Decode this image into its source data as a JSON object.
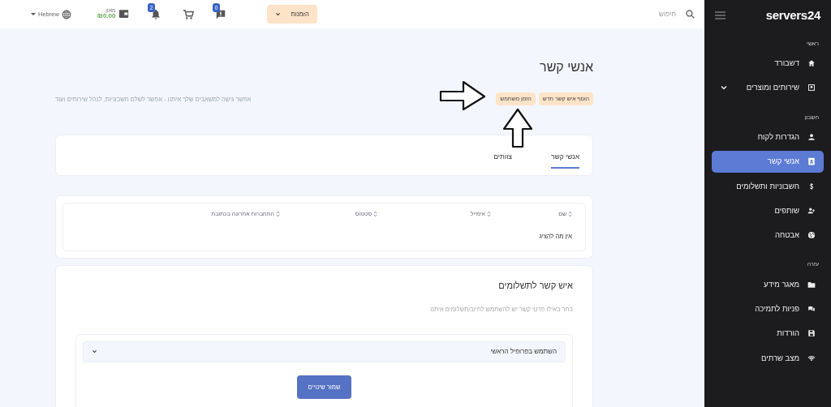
{
  "sidebar": {
    "logo": "servers24",
    "sections": [
      {
        "label": "ראשי",
        "items": [
          {
            "label": "דשבורד",
            "kind": "link",
            "selected": false
          },
          {
            "label": "שירותים ומוצרים",
            "kind": "submenu",
            "selected": false
          }
        ]
      },
      {
        "label": "חשבון",
        "items": [
          {
            "label": "הגדרות לקוח",
            "kind": "link",
            "selected": false
          },
          {
            "label": "אנשי קשר",
            "kind": "link",
            "selected": true
          },
          {
            "label": "חשבוניות ותשלומים",
            "kind": "link",
            "selected": false
          },
          {
            "label": "שותפים",
            "kind": "link",
            "selected": false
          },
          {
            "label": "אבטחה",
            "kind": "link",
            "selected": false
          }
        ]
      },
      {
        "label": "עזרה",
        "items": [
          {
            "label": "מאגר מידע",
            "kind": "link",
            "selected": false
          },
          {
            "label": "פניות לתמיכה",
            "kind": "link",
            "selected": false
          },
          {
            "label": "הורדות",
            "kind": "link",
            "selected": false
          },
          {
            "label": "מצב שרתים",
            "kind": "link",
            "selected": false
          }
        ]
      }
    ]
  },
  "header": {
    "search": {
      "placeholder": "חיפוש"
    },
    "orders_button": "הזמנות",
    "messages_badge": "0",
    "notifications_badge": "2",
    "wallet": {
      "label": "מאזן",
      "amount": "₪0.00"
    },
    "language": "Hebrew"
  },
  "page": {
    "title": "אנשי קשר",
    "subtitle": "אפשר גישה למשאבים שלך איתנו - אפשר לשלם חשבוניות, לנהל שירותים ועוד",
    "buttons": [
      "הוסף איש קשר חדש",
      "הזמן משתמש"
    ]
  },
  "tabs": [
    {
      "label": "אנשי קשר",
      "selected": true
    },
    {
      "label": "צוותים",
      "selected": false
    }
  ],
  "table": {
    "columns": [
      "שם",
      "אימייל",
      "סטטוס",
      "התחברות אחרונה בכתובת"
    ],
    "empty_text": "אין מה להציג"
  },
  "payment_contact": {
    "title": "איש קשר לתשלומים",
    "description": "בחר באילו פרטי קשר יש להשתמש לחיוב/תשלומים איתנו",
    "select_value": "השתמש בפרופיל הראשי",
    "save_button": "שמור שינויים"
  }
}
